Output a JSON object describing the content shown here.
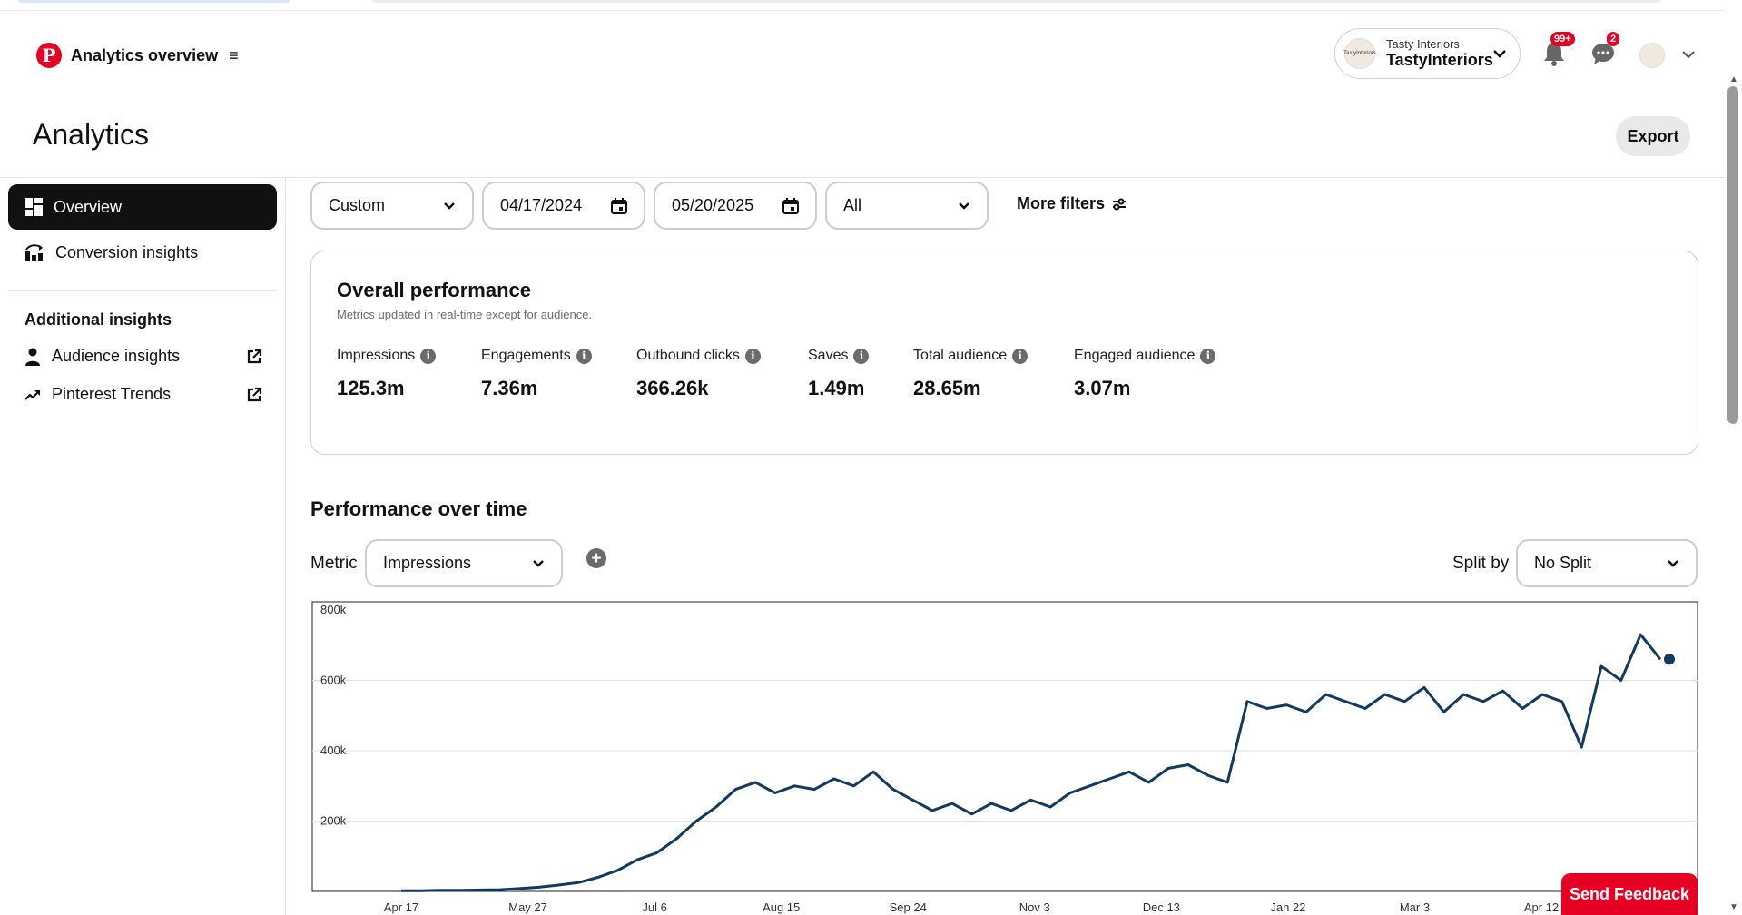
{
  "header": {
    "app_title": "Analytics overview",
    "account": {
      "business_name": "Tasty Interiors",
      "handle": "TastyInteriors",
      "avatar_text": "TastyInteriors"
    },
    "notifications_badge": "99+",
    "messages_badge": "2"
  },
  "page": {
    "title": "Analytics",
    "export_label": "Export"
  },
  "sidebar": {
    "items": [
      {
        "label": "Overview",
        "icon": "grid-icon",
        "active": true
      },
      {
        "label": "Conversion insights",
        "icon": "conversion-icon",
        "active": false
      }
    ],
    "additional_heading": "Additional insights",
    "links": [
      {
        "label": "Audience insights",
        "icon": "person-icon"
      },
      {
        "label": "Pinterest Trends",
        "icon": "trend-icon"
      }
    ]
  },
  "filters": {
    "range_type": "Custom",
    "start_date": "04/17/2024",
    "end_date": "05/20/2025",
    "content_type": "All",
    "more_filters": "More filters"
  },
  "overall": {
    "title": "Overall performance",
    "subtitle": "Metrics updated in real-time except for audience.",
    "metrics": [
      {
        "label": "Impressions",
        "value": "125.3m"
      },
      {
        "label": "Engagements",
        "value": "7.36m"
      },
      {
        "label": "Outbound clicks",
        "value": "366.26k"
      },
      {
        "label": "Saves",
        "value": "1.49m"
      },
      {
        "label": "Total audience",
        "value": "28.65m"
      },
      {
        "label": "Engaged audience",
        "value": "3.07m"
      }
    ]
  },
  "performance": {
    "title": "Performance over time",
    "metric_label": "Metric",
    "metric_value": "Impressions",
    "split_label": "Split by",
    "split_value": "No Split"
  },
  "chart_data": {
    "type": "line",
    "title": "",
    "xlabel": "",
    "ylabel": "",
    "ylim": [
      0,
      800000
    ],
    "y_ticks": [
      "800k",
      "600k",
      "400k",
      "200k"
    ],
    "x_ticks": [
      "Apr 17",
      "May 27",
      "Jul 6",
      "Aug 15",
      "Sep 24",
      "Nov 3",
      "Dec 13",
      "Jan 22",
      "Mar 3",
      "Apr 12"
    ],
    "line_color": "#133a5e",
    "series": [
      {
        "values": [
          2000,
          2000,
          3000,
          3000,
          4000,
          5000,
          8000,
          12000,
          18000,
          25000,
          40000,
          60000,
          90000,
          110000,
          150000,
          200000,
          240000,
          290000,
          310000,
          280000,
          300000,
          290000,
          320000,
          300000,
          340000,
          290000,
          260000,
          230000,
          250000,
          220000,
          250000,
          230000,
          260000,
          240000,
          280000,
          300000,
          320000,
          340000,
          310000,
          350000,
          360000,
          330000,
          310000,
          540000,
          520000,
          530000,
          510000,
          560000,
          540000,
          520000,
          560000,
          540000,
          580000,
          510000,
          560000,
          540000,
          570000,
          520000,
          560000,
          540000,
          410000,
          640000,
          600000,
          730000,
          660000
        ]
      }
    ],
    "last_point_value": 660000
  },
  "feedback": {
    "label": "Send Feedback"
  }
}
